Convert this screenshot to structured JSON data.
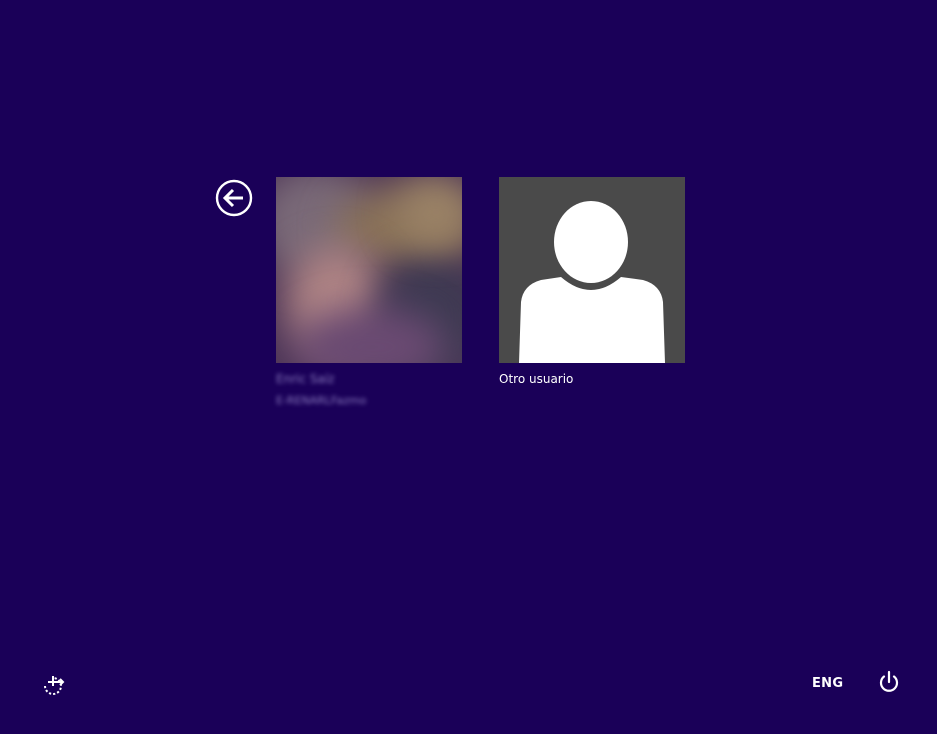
{
  "screen": {
    "background_color": "#1a0058"
  },
  "back_button": {
    "icon": "back-arrow-icon"
  },
  "users": [
    {
      "name": "Enric Saíz",
      "subtitle": "E-RENARLFazmo",
      "avatar": "blurred-photo",
      "blurred": true
    },
    {
      "name": "Otro usuario",
      "subtitle": "",
      "avatar": "generic-person-icon",
      "tile_color": "#4a4a4a"
    }
  ],
  "footer": {
    "ease_of_access_icon": "ease-of-access-icon",
    "language": "ENG",
    "power_icon": "power-icon"
  }
}
